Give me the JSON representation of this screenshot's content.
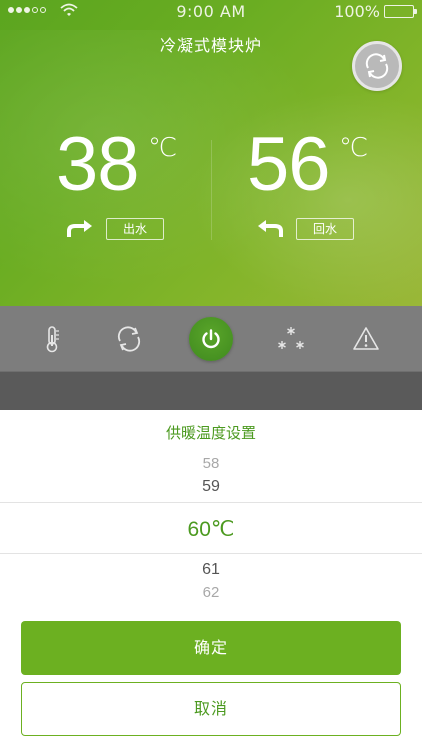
{
  "status_bar": {
    "time": "9:00 AM",
    "battery": "100%",
    "signal_bars_filled": 3,
    "signal_bars_total": 5
  },
  "header": {
    "title": "冷凝式模块炉",
    "refresh_icon": "refresh-icon"
  },
  "outlet": {
    "value": "38",
    "unit": "℃",
    "label": "出水",
    "icon": "outlet-arrow-icon"
  },
  "return": {
    "value": "56",
    "unit": "℃",
    "label": "回水",
    "icon": "return-arrow-icon"
  },
  "toolbar": {
    "items": [
      {
        "icon": "thermometer-icon"
      },
      {
        "icon": "cycle-icon"
      },
      {
        "icon": "power-icon"
      },
      {
        "icon": "snowflake-icon"
      },
      {
        "icon": "warning-icon"
      }
    ]
  },
  "picker": {
    "title": "供暖温度设置",
    "options": [
      "58",
      "59",
      "60℃",
      "61",
      "62"
    ],
    "selected": "60℃"
  },
  "actions": {
    "confirm_label": "确定",
    "cancel_label": "取消"
  },
  "colors": {
    "accent": "#6cb021",
    "accent_text": "#4c9a20",
    "toolbar_bg": "#7d7d7d"
  }
}
